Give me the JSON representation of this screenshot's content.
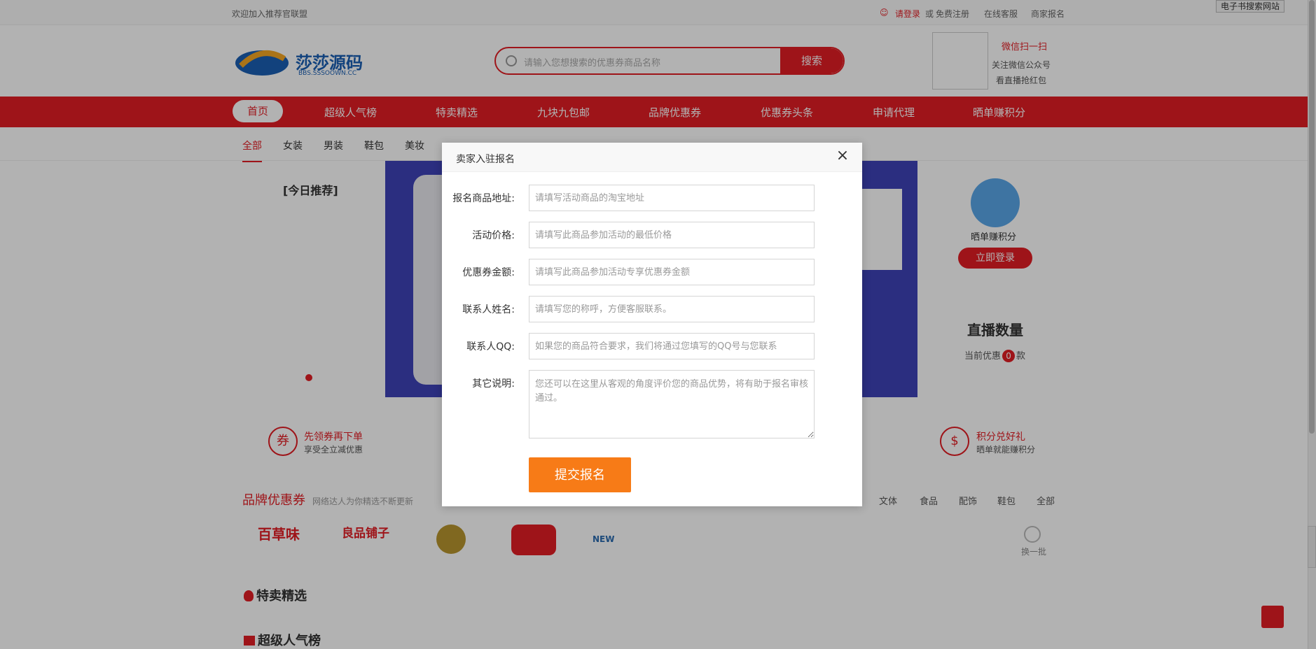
{
  "topbar": {
    "welcome": "欢迎加入推荐官联盟",
    "login": "请登录",
    "or": "或",
    "register": "免费注册",
    "service": "在线客服",
    "merchant": "商家报名"
  },
  "browser_ext": {
    "label": "电子书搜索网站"
  },
  "header": {
    "logo_text": "莎莎源码",
    "logo_sub": "BBS.SSSOOWN.CC",
    "search_placeholder": "请输入您想搜索的优惠券商品名称",
    "search_button": "搜索",
    "wechat_title": "微信扫一扫",
    "wechat_line1": "关注微信公众号",
    "wechat_line2": "看直播抢红包"
  },
  "nav": {
    "items": [
      "首页",
      "超级人气榜",
      "特卖精选",
      "九块九包邮",
      "品牌优惠券",
      "优惠券头条",
      "申请代理",
      "晒单赚积分"
    ]
  },
  "categories": {
    "items": [
      "全部",
      "女装",
      "男装",
      "鞋包",
      "美妆"
    ]
  },
  "banner": {
    "today_label": "[今日推荐]"
  },
  "sidebar": {
    "label": "晒单赚积分",
    "button": "立即登录",
    "live_title": "直播数量",
    "live_prefix": "当前优惠",
    "live_count": "0",
    "live_suffix": "款"
  },
  "features": [
    {
      "icon": "券",
      "title": "先领券再下单",
      "sub": "享受全立减优惠"
    },
    {
      "icon": "$",
      "title": "积分兑好礼",
      "sub": "晒单就能赚积分"
    }
  ],
  "brands": {
    "title": "品牌优惠券",
    "subtitle": "网络达人为你精选不断更新",
    "tabs": [
      "文体",
      "食品",
      "配饰",
      "鞋包",
      "全部"
    ],
    "logos": [
      "百草味",
      "良品铺子",
      "",
      "",
      "NEW"
    ],
    "refresh": "换一批"
  },
  "sections": {
    "hot": "特卖精选",
    "popular": "超级人气榜"
  },
  "modal": {
    "title": "卖家入驻报名",
    "close": "×",
    "fields": [
      {
        "label": "报名商品地址:",
        "placeholder": "请填写活动商品的淘宝地址"
      },
      {
        "label": "活动价格:",
        "placeholder": "请填写此商品参加活动的最低价格"
      },
      {
        "label": "优惠券金额:",
        "placeholder": "请填写此商品参加活动专享优惠券金额"
      },
      {
        "label": "联系人姓名:",
        "placeholder": "请填写您的称呼，方便客服联系。"
      },
      {
        "label": "联系人QQ:",
        "placeholder": "如果您的商品符合要求，我们将通过您填写的QQ号与您联系"
      },
      {
        "label": "其它说明:",
        "placeholder": "您还可以在这里从客观的角度评价您的商品优势，将有助于报名审核通过。"
      }
    ],
    "submit": "提交报名"
  },
  "colors": {
    "brand_red": "#e31e24",
    "submit_orange": "#f77b17"
  }
}
